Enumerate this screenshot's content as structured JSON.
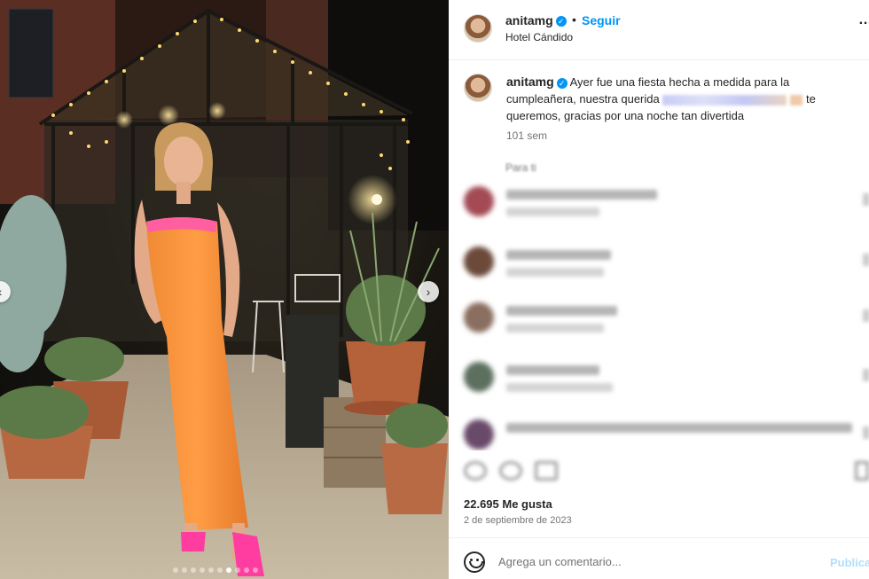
{
  "post": {
    "username": "anitamg",
    "follow_label": "Seguir",
    "separator": "•",
    "location": "Hotel Cándido",
    "more_icon": "more-options-icon",
    "verified_icon": "verified-badge-icon"
  },
  "caption": {
    "username": "anitamg",
    "text_before": "Ayer fue una fiesta hecha a medida para la cumpleañera, nuestra querida",
    "text_after": "te queremos, gracias por una noche tan divertida",
    "time": "101 sem"
  },
  "section_label": "Para ti",
  "comments": [
    {
      "avatar_color": "#a34a55"
    },
    {
      "avatar_color": "#6b4a3a"
    },
    {
      "avatar_color": "#8a6e60"
    },
    {
      "avatar_color": "#5d7060"
    },
    {
      "avatar_color": "#6a4a6a"
    }
  ],
  "stats": {
    "likes": "22.695 Me gusta",
    "date": "2 de septiembre de 2023"
  },
  "composer": {
    "placeholder": "Agrega un comentario...",
    "publish_label": "Publicar"
  },
  "carousel": {
    "slide_count": 10,
    "active_index": 6
  }
}
